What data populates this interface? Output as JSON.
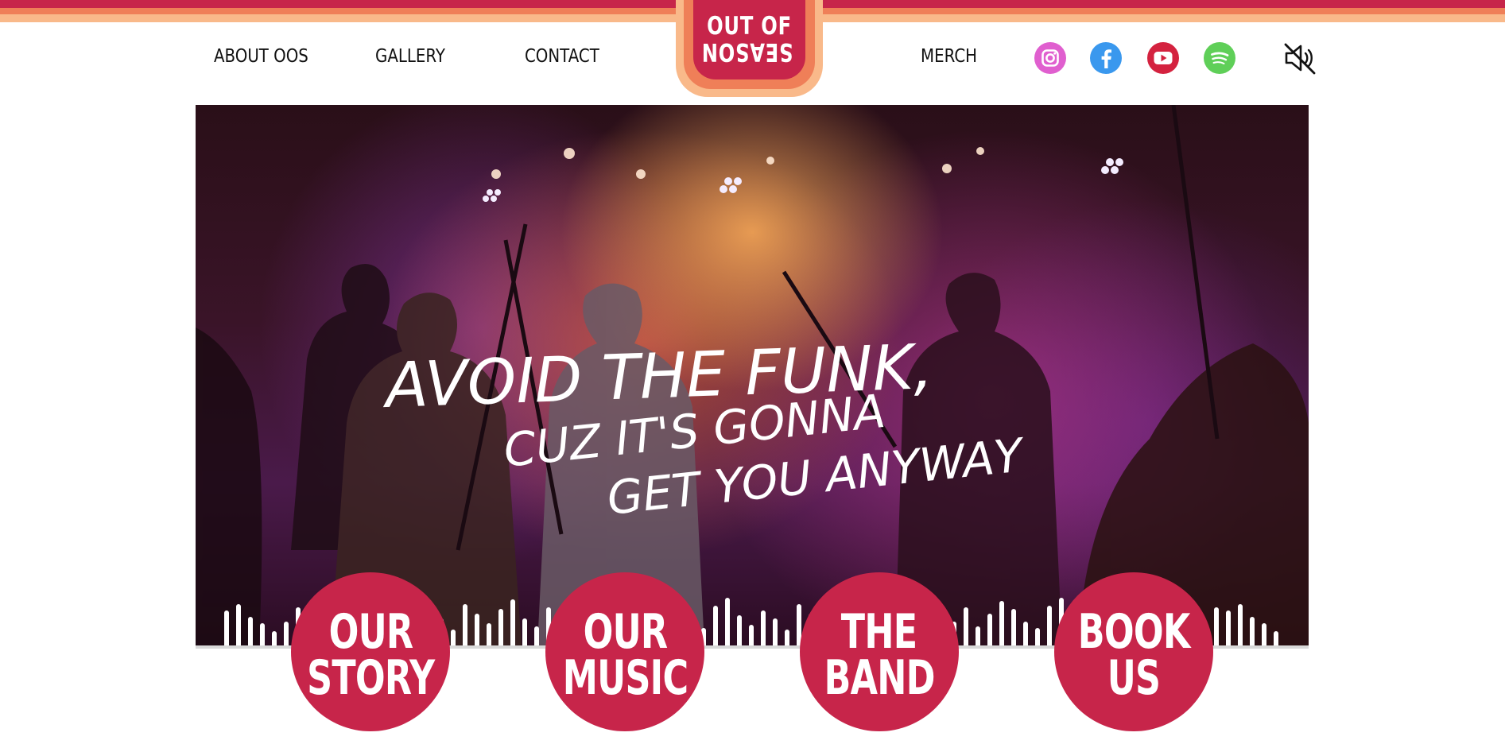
{
  "brand": {
    "logo_line1": "OUT OF",
    "logo_line2": "SEASON",
    "colors": {
      "crimson": "#c7254a",
      "orange": "#ef7f58",
      "peach": "#f9b98a"
    }
  },
  "nav": {
    "left": [
      "ABOUT OOS",
      "GALLERY",
      "CONTACT"
    ],
    "right": [
      "MERCH"
    ]
  },
  "social": [
    {
      "icon": "instagram-icon",
      "color": "#e05fcf"
    },
    {
      "icon": "facebook-icon",
      "color": "#3a98ee"
    },
    {
      "icon": "youtube-icon",
      "color": "#d4223f"
    },
    {
      "icon": "spotify-icon",
      "color": "#5fcf58"
    }
  ],
  "sound_toggle": {
    "icon": "speaker-muted-icon"
  },
  "hero": {
    "tagline_line1": "AVOID THE FUNK,",
    "tagline_line2": "CUZ IT'S GONNA",
    "tagline_line3": "GET YOU ANYWAY"
  },
  "buttons": [
    {
      "line1": "OUR",
      "line2": "STORY"
    },
    {
      "line1": "OUR",
      "line2": "MUSIC"
    },
    {
      "line1": "THE",
      "line2": "BAND"
    },
    {
      "line1": "BOOK",
      "line2": "US"
    }
  ]
}
